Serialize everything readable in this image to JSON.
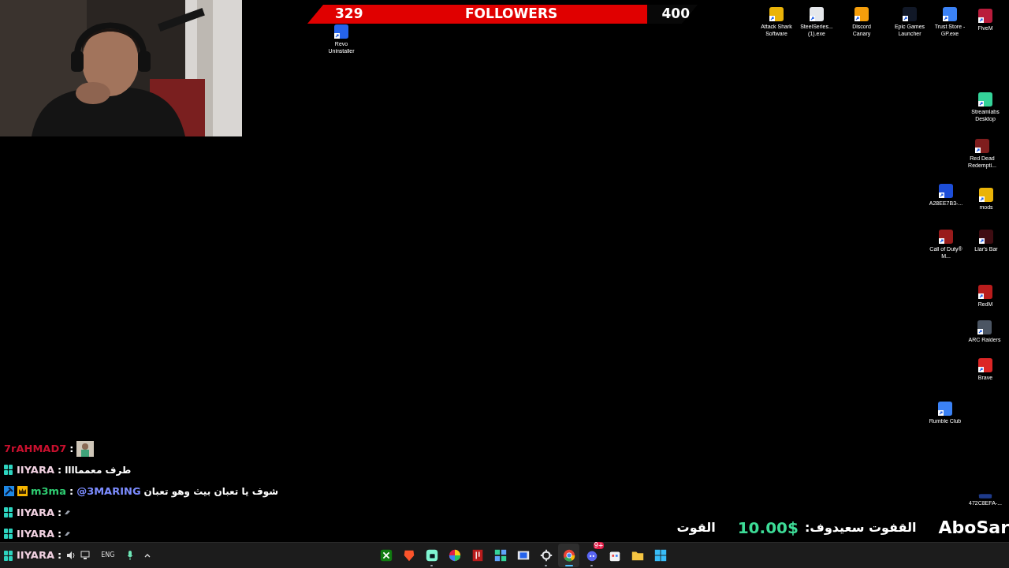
{
  "follower_goal": {
    "current": "329",
    "label": "FOLLOWERS",
    "target": "400",
    "level": 0.87
  },
  "desktop_icons": [
    {
      "label": "Revo Uninstaller"
    },
    {
      "label": "Attack Shark Software"
    },
    {
      "label": "SteelSeries... (1).exe"
    },
    {
      "label": "Discord Canary"
    },
    {
      "label": "Epic Games Launcher"
    },
    {
      "label": "Trust Store - GP.exe"
    },
    {
      "label": "FiveM"
    },
    {
      "label": "Streamlabs Desktop"
    },
    {
      "label": "Red Dead Redempti..."
    },
    {
      "label": "A28EE7B3-..."
    },
    {
      "label": "mods"
    },
    {
      "label": "Call of Duty® M..."
    },
    {
      "label": "Liar's Bar"
    },
    {
      "label": "RedM"
    },
    {
      "label": "ARC Raiders"
    },
    {
      "label": "Brave"
    },
    {
      "label": "Rumble Club"
    },
    {
      "label": "472C8EFA-..."
    }
  ],
  "chat": [
    {
      "user": "7rAHMAD7",
      "color": "#c8102e",
      "separator": ":",
      "parts": [
        {
          "kind": "emote"
        }
      ]
    },
    {
      "user": "IIYARA",
      "color": "#f0d0e0",
      "badges": [
        {
          "kind": "gg"
        }
      ],
      "separator": ":",
      "parts": [
        {
          "kind": "text",
          "text": "طرف معمماااا"
        }
      ]
    },
    {
      "user": "m3ma",
      "color": "#2ecc71",
      "badges": [
        {
          "kind": "hammer"
        },
        {
          "kind": "crown"
        }
      ],
      "separator": ":",
      "parts": [
        {
          "kind": "mention",
          "text": "@3MARING"
        },
        {
          "kind": "text",
          "text": "شوف يا تعبان بيث وهو تعبان"
        }
      ]
    },
    {
      "user": "IIYARA",
      "color": "#f0d0e0",
      "badges": [
        {
          "kind": "gg"
        }
      ],
      "separator": ":",
      "parts": [
        {
          "kind": "small-emote"
        }
      ]
    },
    {
      "user": "IIYARA",
      "color": "#f0d0e0",
      "badges": [
        {
          "kind": "gg"
        }
      ],
      "separator": ":",
      "parts": [
        {
          "kind": "small-emote"
        }
      ]
    },
    {
      "user": "IIYARA",
      "color": "#f0d0e0",
      "badges": [
        {
          "kind": "gg"
        }
      ],
      "separator": ":"
    }
  ],
  "ticker": [
    {
      "kind": "text",
      "text": "القوت"
    },
    {
      "kind": "amount",
      "text": "10.00$"
    },
    {
      "kind": "text",
      "text": "القفوت سعيدوف:"
    },
    {
      "kind": "name",
      "text": "AboSar"
    }
  ],
  "taskbar": {
    "apps": [
      {
        "kind": "xbox",
        "running": false,
        "selected": false
      },
      {
        "kind": "brave",
        "running": false,
        "selected": false
      },
      {
        "kind": "streamlabs",
        "running": true,
        "selected": false
      },
      {
        "kind": "colors",
        "running": false,
        "selected": false
      },
      {
        "kind": "redm",
        "running": false,
        "selected": false
      },
      {
        "kind": "tiles",
        "running": false,
        "selected": false
      },
      {
        "kind": "window",
        "running": false,
        "selected": false
      },
      {
        "kind": "steelseries",
        "running": true,
        "selected": false
      },
      {
        "kind": "chrome",
        "running": true,
        "selected": true
      },
      {
        "kind": "discord",
        "running": true,
        "selected": false,
        "badge": "9+"
      },
      {
        "kind": "store",
        "running": false,
        "selected": false
      },
      {
        "kind": "explorer",
        "running": false,
        "selected": false
      },
      {
        "kind": "windows",
        "running": false,
        "selected": false
      }
    ],
    "language": "ENG"
  }
}
